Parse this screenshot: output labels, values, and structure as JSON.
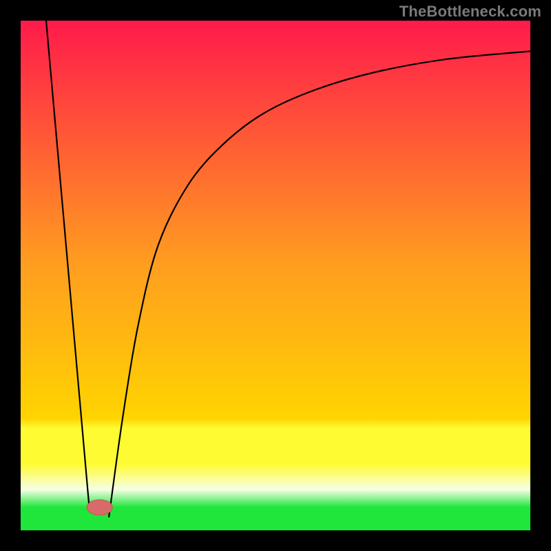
{
  "watermark": "TheBottleneck.com",
  "colors": {
    "frame": "#000000",
    "top": "#ff1a4b",
    "mid": "#ffd400",
    "yellow_plateau": "#fffb33",
    "pale": "#f6ffe6",
    "green": "#1ee63a",
    "curve": "#000000",
    "marker_fill": "#d96a6a",
    "marker_stroke": "#c94f4f"
  },
  "chart_data": {
    "type": "line",
    "title": "",
    "xlabel": "",
    "ylabel": "",
    "xlim": [
      0,
      100
    ],
    "ylim": [
      0,
      100
    ],
    "grid": false,
    "legend": false,
    "series": [
      {
        "name": "left-branch",
        "x": [
          5,
          13.5
        ],
        "values": [
          100,
          4
        ],
        "note": "Straight descent from top-left into the trough"
      },
      {
        "name": "trough",
        "x": [
          13.5,
          17.5
        ],
        "values": [
          4,
          4
        ],
        "note": "Flat minimum segment"
      },
      {
        "name": "right-branch",
        "x": [
          17.5,
          20,
          23,
          27,
          33,
          40,
          48,
          58,
          70,
          84,
          100
        ],
        "values": [
          4,
          22,
          40,
          56,
          68,
          76,
          82,
          86.5,
          90,
          92.5,
          94
        ],
        "note": "Steep rise that tapers to an asymptote near y≈94"
      }
    ],
    "marker": {
      "x": 15.5,
      "y": 4.5,
      "rx": 2.5,
      "ry": 1.5,
      "note": "Small lozenge marker sitting in the trough"
    },
    "axes_visible": false
  }
}
